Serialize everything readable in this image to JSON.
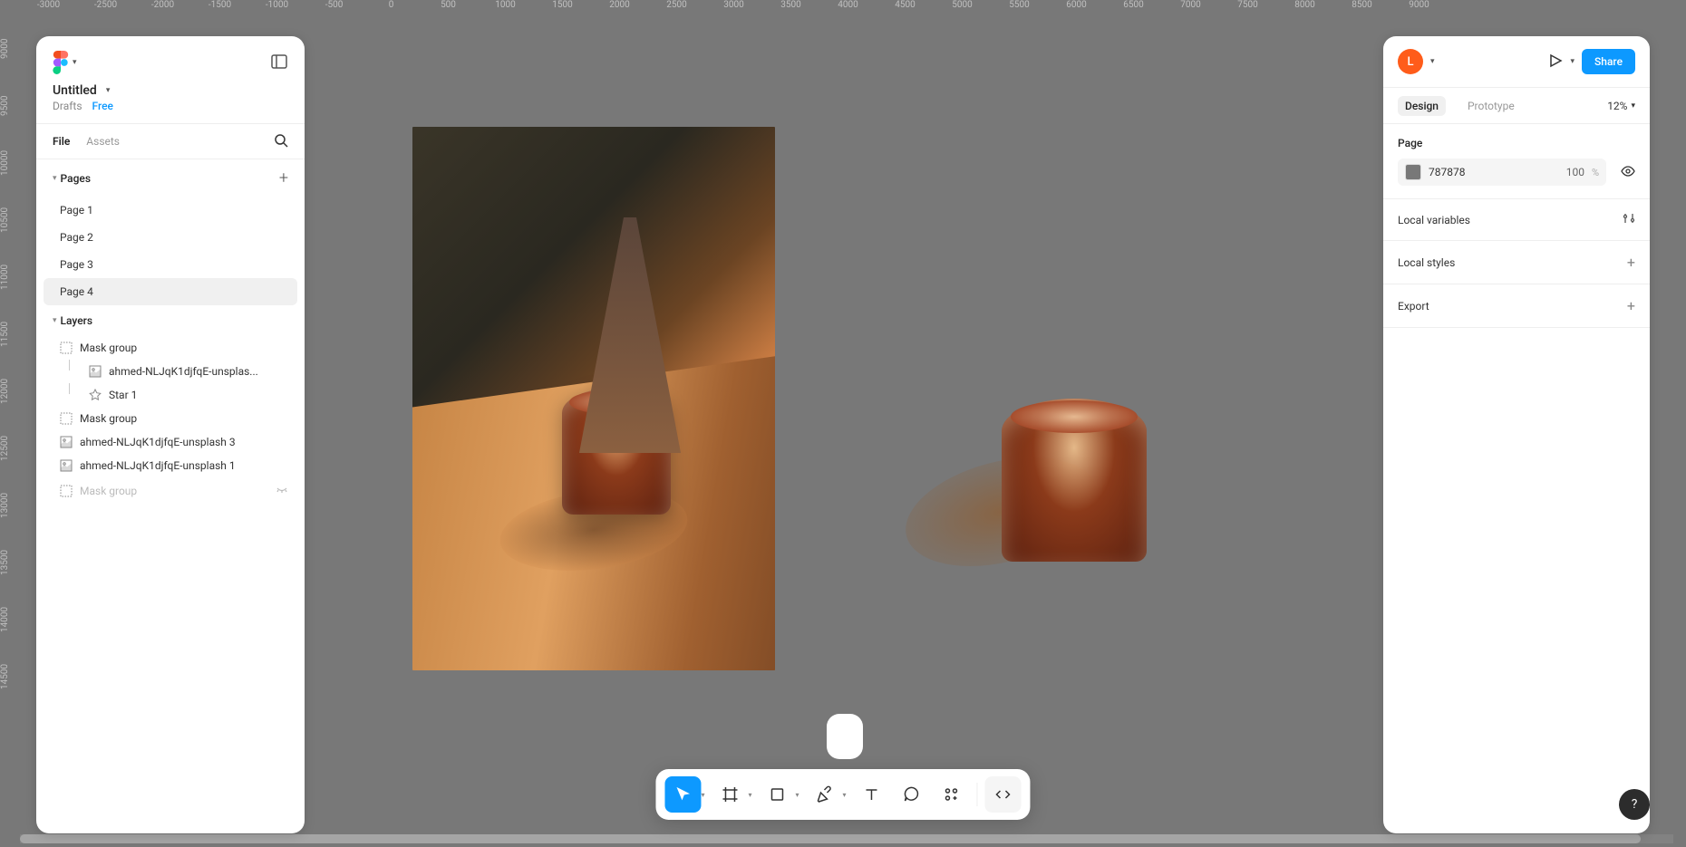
{
  "ruler_h": [
    "-3000",
    "-2500",
    "-2000",
    "-1500",
    "-1000",
    "-500",
    "0",
    "500",
    "1000",
    "1500",
    "2000",
    "2500",
    "3000",
    "3500",
    "4000",
    "4500",
    "5000",
    "5500",
    "6000",
    "6500",
    "7000",
    "7500",
    "8000",
    "8500",
    "9000"
  ],
  "ruler_v": [
    "9000",
    "9500",
    "10000",
    "10500",
    "11000",
    "11500",
    "12000",
    "12500",
    "13000",
    "13500",
    "14000",
    "14500"
  ],
  "file": {
    "title": "Untitled",
    "location": "Drafts",
    "plan": "Free"
  },
  "left_tabs": {
    "file": "File",
    "assets": "Assets"
  },
  "pages_header": "Pages",
  "pages": [
    "Page 1",
    "Page 2",
    "Page 3",
    "Page 4"
  ],
  "active_page_index": 3,
  "layers_header": "Layers",
  "layers": [
    {
      "name": "Mask group",
      "icon": "mask",
      "depth": 0,
      "hidden": false
    },
    {
      "name": "ahmed-NLJqK1djfqE-unsplas...",
      "icon": "image",
      "depth": 1,
      "hidden": false
    },
    {
      "name": "Star 1",
      "icon": "star",
      "depth": 1,
      "hidden": false
    },
    {
      "name": "Mask group",
      "icon": "mask",
      "depth": 0,
      "hidden": false
    },
    {
      "name": "ahmed-NLJqK1djfqE-unsplash 3",
      "icon": "image",
      "depth": 0,
      "hidden": false
    },
    {
      "name": "ahmed-NLJqK1djfqE-unsplash 1",
      "icon": "image",
      "depth": 0,
      "hidden": false
    },
    {
      "name": "Mask group",
      "icon": "mask",
      "depth": 0,
      "hidden": true
    }
  ],
  "user": {
    "initial": "L"
  },
  "share_label": "Share",
  "right_tabs": {
    "design": "Design",
    "prototype": "Prototype"
  },
  "zoom": "12%",
  "page_section": {
    "title": "Page",
    "hex": "787878",
    "opacity": "100",
    "pct": "%"
  },
  "sections": {
    "local_variables": "Local variables",
    "local_styles": "Local styles",
    "export": "Export"
  },
  "help": "?"
}
